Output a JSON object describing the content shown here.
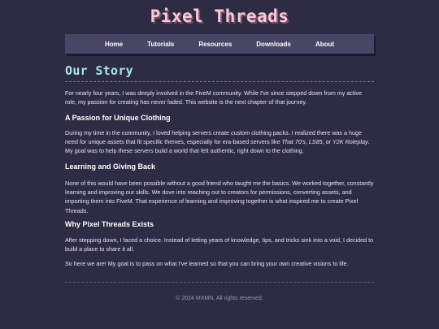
{
  "site": {
    "title": "Pixel Threads"
  },
  "nav": {
    "items": [
      {
        "label": "Home"
      },
      {
        "label": "Tutorials"
      },
      {
        "label": "Resources"
      },
      {
        "label": "Downloads"
      },
      {
        "label": "About"
      }
    ]
  },
  "main": {
    "title": "Our Story",
    "intro": "For nearly four years, I was deeply involved in the FiveM community. While I've since stepped down from my active role, my passion for creating has never faded. This website is the next chapter of that journey.",
    "sections": [
      {
        "heading": "A Passion for Unique Clothing",
        "text_before": "During my time in the community, I loved helping servers create custom clothing packs. I realized there was a huge need for unique assets that fit specific themes, especially for era-based servers like ",
        "em1": "That 70's",
        "sep1": ", ",
        "em2": "LS85",
        "sep2": ", or ",
        "em3": "Y2K Roleplay",
        "text_after": ". My goal was to help these servers build a world that felt authentic, right down to the clothing."
      },
      {
        "heading": "Learning and Giving Back",
        "text": "None of this would have been possible without a good friend who taught me the basics. We worked together, constantly learning and improving our skills. We dove into reaching out to creators for permissions, converting assets, and importing them into FiveM. That experience of learning and improving together is what inspired me to create Pixel Threads."
      },
      {
        "heading": "Why Pixel Threads Exists",
        "text": "After stepping down, I faced a choice. Instead of letting years of knowledge, tips, and tricks sink into a void, I decided to build a place to share it all.",
        "closing": "So here we are! My goal is to pass on what I've learned so that you can bring your own creative visions to life."
      }
    ]
  },
  "footer": {
    "text": "© 2024 MXMN. All rights reserved."
  }
}
